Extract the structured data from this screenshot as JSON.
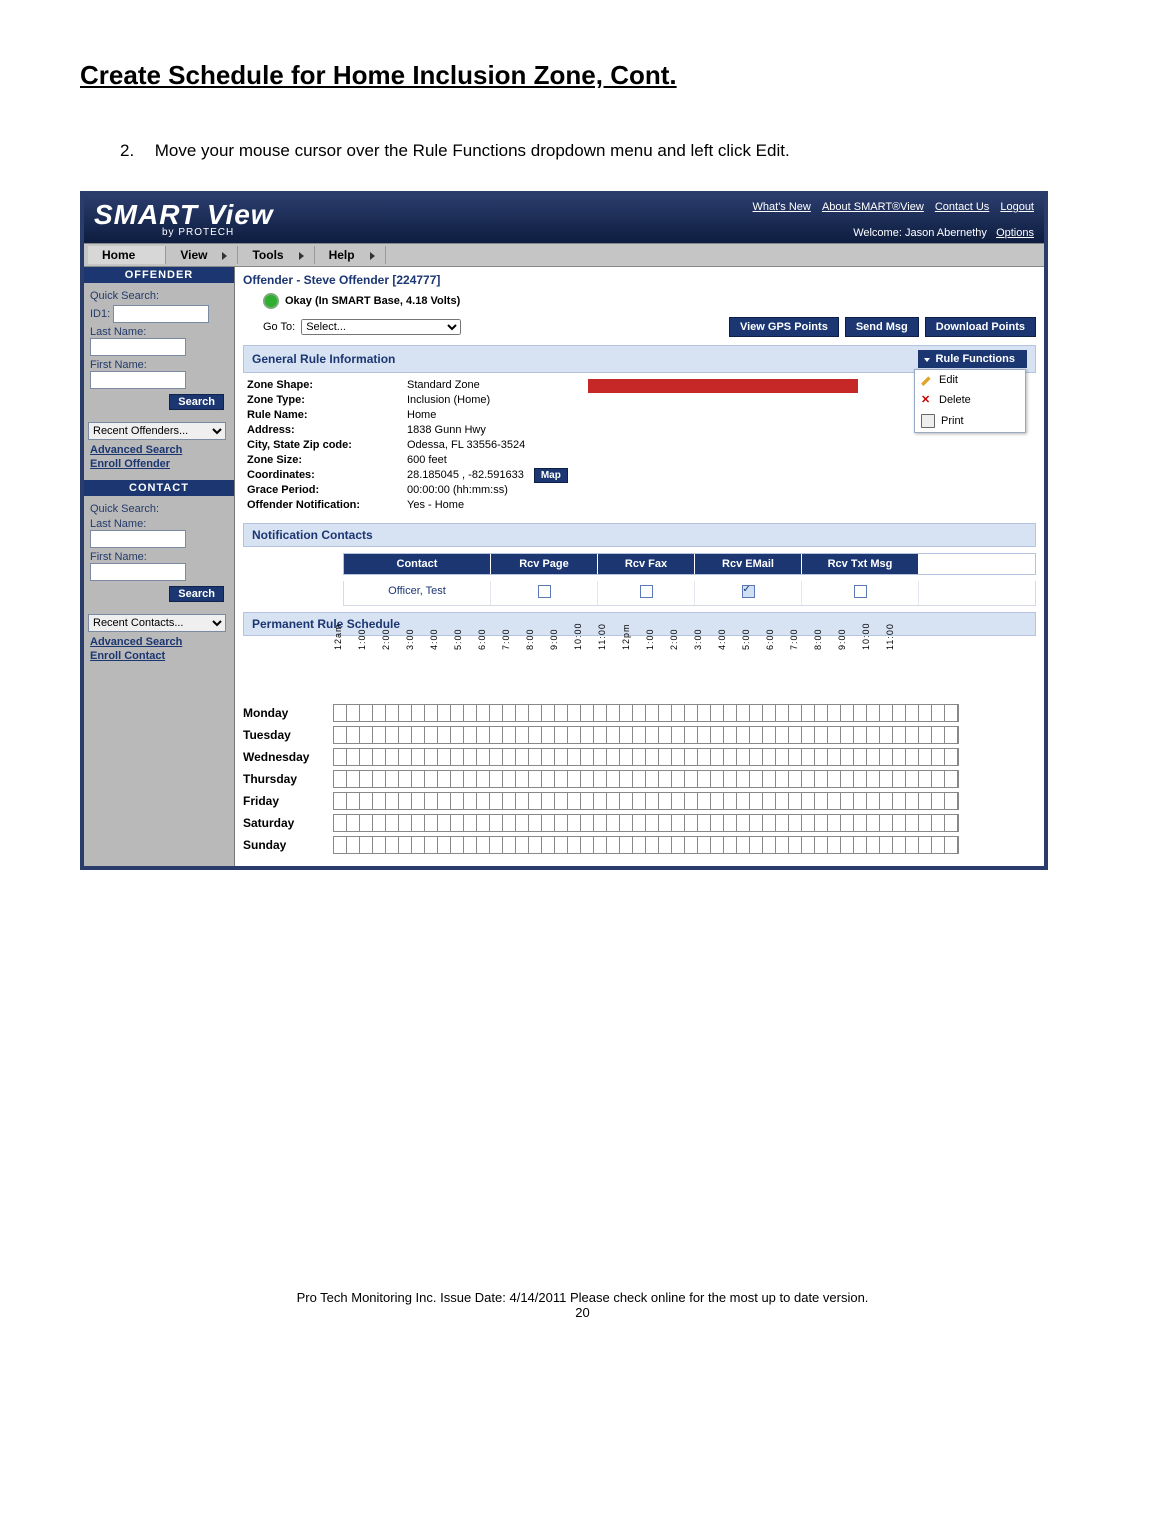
{
  "page": {
    "title": "Create Schedule for Home Inclusion Zone, Cont.",
    "step_number": "2.",
    "step_text": "Move your mouse cursor over the Rule Functions dropdown menu and left click Edit."
  },
  "header": {
    "logo_main": "SMART View",
    "logo_sub": "by PROTECH",
    "top_links": [
      "What's New",
      "About SMART®View",
      "Contact Us",
      "Logout"
    ],
    "welcome_prefix": "Welcome: ",
    "welcome_user": "Jason Abernethy",
    "options": "Options"
  },
  "menu": [
    "Home",
    "View",
    "Tools",
    "Help"
  ],
  "offender_panel": {
    "title": "OFFENDER",
    "quick": "Quick Search:",
    "id1": "ID1:",
    "last": "Last Name:",
    "first": "First Name:",
    "search": "Search",
    "recent": "Recent Offenders...",
    "adv": "Advanced Search",
    "enroll": "Enroll Offender"
  },
  "contact_panel": {
    "title": "CONTACT",
    "quick": "Quick Search:",
    "last": "Last Name:",
    "first": "First Name:",
    "search": "Search",
    "recent": "Recent Contacts...",
    "adv": "Advanced Search",
    "enroll": "Enroll Contact"
  },
  "offender_detail": {
    "title": "Offender - Steve Offender [224777]",
    "status": "Okay (In SMART Base, 4.18 Volts)",
    "goto_label": "Go To:",
    "goto_value": "Select...",
    "btn_gps": "View GPS Points",
    "btn_send": "Send Msg",
    "btn_dl": "Download Points"
  },
  "general_rule": {
    "header": "General Rule Information",
    "rule_functions": "Rule Functions",
    "menu": {
      "edit": "Edit",
      "delete": "Delete",
      "print": "Print"
    },
    "fields": {
      "Zone Shape:": "Standard Zone",
      "Zone Type:": "Inclusion (Home)",
      "Rule Name:": "Home",
      "Address:": "1838 Gunn Hwy",
      "City, State Zip code:": "Odessa, FL 33556-3524",
      "Zone Size:": "600 feet",
      "Coordinates:": "28.185045 , -82.591633",
      "Grace Period:": "00:00:00   (hh:mm:ss)",
      "Offender Notification:": "Yes - Home"
    },
    "map_btn": "Map"
  },
  "notification": {
    "header": "Notification Contacts",
    "columns": [
      "Contact",
      "Rcv Page",
      "Rcv Fax",
      "Rcv EMail",
      "Rcv Txt Msg"
    ],
    "row": {
      "contact": "Officer, Test",
      "page": false,
      "fax": false,
      "email": true,
      "txt": false
    }
  },
  "schedule": {
    "header": "Permanent Rule Schedule",
    "hours": [
      "12am",
      "1:00",
      "2:00",
      "3:00",
      "4:00",
      "5:00",
      "6:00",
      "7:00",
      "8:00",
      "9:00",
      "10:00",
      "11:00",
      "12pm",
      "1:00",
      "2:00",
      "3:00",
      "4:00",
      "5:00",
      "6:00",
      "7:00",
      "8:00",
      "9:00",
      "10:00",
      "11:00"
    ],
    "days": [
      "Monday",
      "Tuesday",
      "Wednesday",
      "Thursday",
      "Friday",
      "Saturday",
      "Sunday"
    ]
  },
  "footer": {
    "line": "Pro Tech Monitoring Inc. Issue Date: 4/14/2011 Please check online for the most up to date version.",
    "page": "20"
  }
}
